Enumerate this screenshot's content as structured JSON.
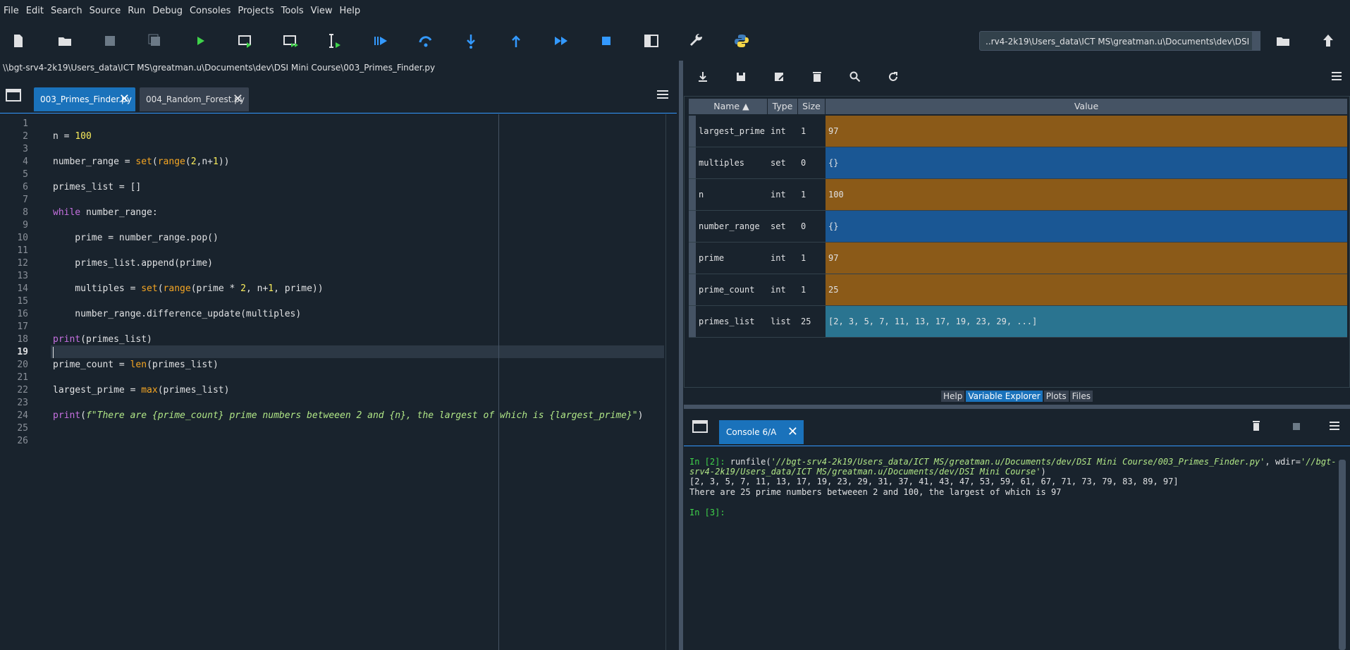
{
  "menu": [
    "File",
    "Edit",
    "Search",
    "Source",
    "Run",
    "Debug",
    "Consoles",
    "Projects",
    "Tools",
    "View",
    "Help"
  ],
  "toolbar": {
    "working_dir": "..rv4-2k19\\Users_data\\ICT MS\\greatman.u\\Documents\\dev\\DSI Mini Course"
  },
  "editor": {
    "path": "\\\\bgt-srv4-2k19\\Users_data\\ICT MS\\greatman.u\\Documents\\dev\\DSI Mini Course\\003_Primes_Finder.py",
    "tabs": [
      {
        "label": "003_Primes_Finder.py"
      },
      {
        "label": "004_Random_Forest.py"
      }
    ],
    "current_line": "19",
    "line_numbers": [
      "1",
      "2",
      "3",
      "4",
      "5",
      "6",
      "7",
      "8",
      "9",
      "10",
      "11",
      "12",
      "13",
      "14",
      "15",
      "16",
      "17",
      "18",
      "19",
      "20",
      "21",
      "22",
      "23",
      "24",
      "25",
      "26"
    ],
    "code": {
      "l2a": "n = ",
      "l2b": "100",
      "l4a": "number_range = ",
      "l4b": "set",
      "l4c": "(",
      "l4d": "range",
      "l4e": "(",
      "l4f": "2",
      "l4g": ",n+",
      "l4h": "1",
      "l4i": "))",
      "l6": "primes_list = []",
      "l8a": "while",
      "l8b": " number_range:",
      "l10": "    prime = number_range.pop()",
      "l12": "    primes_list.append(prime)",
      "l14a": "    multiples = ",
      "l14b": "set",
      "l14c": "(",
      "l14d": "range",
      "l14e": "(prime * ",
      "l14f": "2",
      "l14g": ", n+",
      "l14h": "1",
      "l14i": ", prime))",
      "l16": "    number_range.difference_update(multiples)",
      "l18a": "print",
      "l18b": "(primes_list)",
      "l20a": "prime_count = ",
      "l20b": "len",
      "l20c": "(primes_list)",
      "l22a": "largest_prime = ",
      "l22b": "max",
      "l22c": "(primes_list)",
      "l24a": "print",
      "l24b": "(",
      "l24c": "f",
      "l24d": "\"There are {prime_count} prime numbers betweeen 2 and {n}, the largest of which is {largest_prime}\"",
      "l24e": ")"
    }
  },
  "variable_explorer": {
    "headers": {
      "name": "Name",
      "type": "Type",
      "size": "Size",
      "value": "Value"
    },
    "rows": [
      {
        "name": "largest_prime",
        "type": "int",
        "size": "1",
        "value": "97",
        "color": "#8b5a18"
      },
      {
        "name": "multiples",
        "type": "set",
        "size": "0",
        "value": "{}",
        "color": "#1a5794"
      },
      {
        "name": "n",
        "type": "int",
        "size": "1",
        "value": "100",
        "color": "#8b5a18"
      },
      {
        "name": "number_range",
        "type": "set",
        "size": "0",
        "value": "{}",
        "color": "#1a5794"
      },
      {
        "name": "prime",
        "type": "int",
        "size": "1",
        "value": "97",
        "color": "#8b5a18"
      },
      {
        "name": "prime_count",
        "type": "int",
        "size": "1",
        "value": "25",
        "color": "#8b5a18"
      },
      {
        "name": "primes_list",
        "type": "list",
        "size": "25",
        "value": "[2, 3, 5, 7, 11, 13, 17, 19, 23, 29, ...]",
        "color": "#2a7490"
      }
    ]
  },
  "pane_tabs": [
    "Help",
    "Variable Explorer",
    "Plots",
    "Files"
  ],
  "console": {
    "tab": "Console 6/A",
    "in2": "In [2]:",
    "cmd_a": " runfile(",
    "cmd_b": "'//bgt-srv4-2k19/Users_data/ICT MS/greatman.u/Documents/dev/DSI Mini Course/003_Primes_Finder.py'",
    "cmd_c": ", wdir=",
    "cmd_d": "'//bgt-",
    "cmd2": "srv4-2k19/Users_data/ICT MS/greatman.u/Documents/dev/DSI Mini Course'",
    "cmd2b": ")",
    "out1": "[2, 3, 5, 7, 11, 13, 17, 19, 23, 29, 31, 37, 41, 43, 47, 53, 59, 61, 67, 71, 73, 79, 83, 89, 97]",
    "out2": "There are 25 prime numbers betweeen 2 and 100, the largest of which is 97",
    "in3": "In [3]:"
  }
}
